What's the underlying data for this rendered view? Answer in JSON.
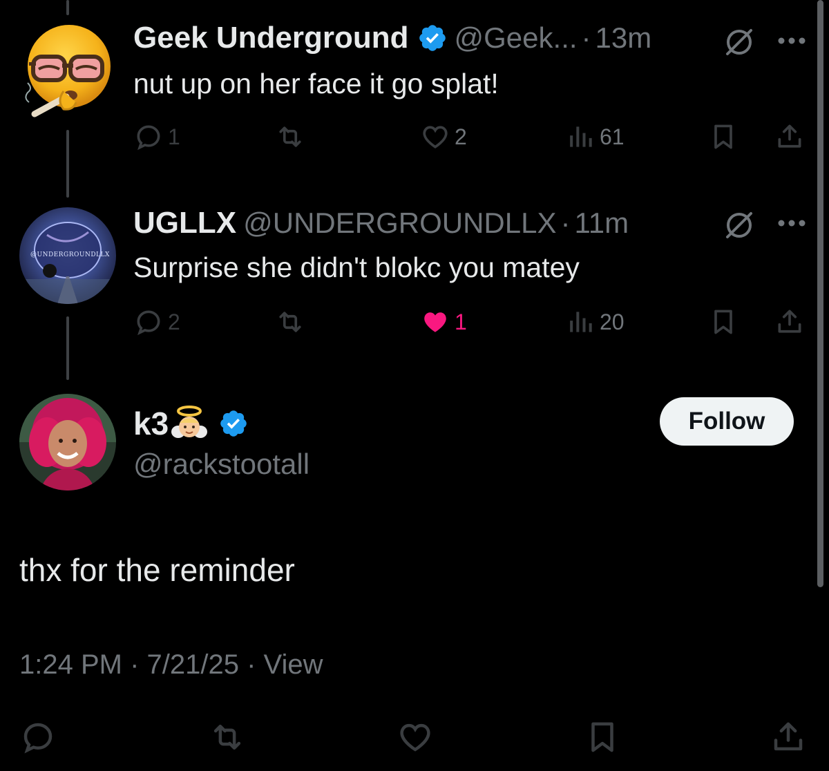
{
  "replies": [
    {
      "name": "Geek Underground",
      "handle": "@Geek...",
      "dot": "·",
      "time": "13m",
      "text": "nut up on her face it go splat!",
      "counts": {
        "reply": "1",
        "retweet": "",
        "like": "2",
        "views": "61"
      },
      "liked": false
    },
    {
      "name": "UGLLX",
      "handle": "@UNDERGROUNDLLX",
      "dot": "·",
      "time": "11m",
      "avatar_text": "@UNDERGROUNDLLX",
      "text": "Surprise she didn't blokc you matey",
      "counts": {
        "reply": "2",
        "retweet": "",
        "like": "1",
        "views": "20"
      },
      "liked": true
    }
  ],
  "main": {
    "name": "k3",
    "handle": "@rackstootall",
    "follow_label": "Follow",
    "text": "thx for the reminder",
    "meta": "1:24 PM · 7/21/25 · View"
  },
  "colors": {
    "background": "#000000",
    "text": "#e7e9ea",
    "muted": "#71767b",
    "verified": "#1d9bf0",
    "like": "#f91880"
  },
  "icons": [
    "reply-icon",
    "retweet-icon",
    "like-icon",
    "views-icon",
    "bookmark-icon",
    "share-icon",
    "grok-icon",
    "more-icon",
    "verified-icon"
  ]
}
